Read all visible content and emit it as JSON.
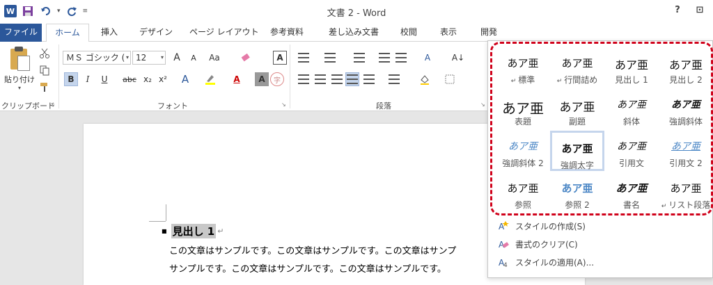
{
  "title_bar": {
    "word_logo": "W",
    "doc_title": "文書 2 - Word",
    "help": "?",
    "ribbon_display": "⊡"
  },
  "tabs": [
    "ファイル",
    "ホーム",
    "挿入",
    "デザイン",
    "ページ レイアウト",
    "参考資料",
    "差し込み文書",
    "校閲",
    "表示",
    "開発"
  ],
  "ribbon": {
    "paste_label": "貼り付け",
    "clipboard_label": "クリップボード",
    "font_label": "フォント",
    "paragraph_label": "段落",
    "font_name": "ＭＳ ゴシック (",
    "font_size": "12",
    "font_buttons": {
      "grow": "A",
      "shrink": "A",
      "case": "Aa",
      "bold": "B",
      "italic": "I",
      "underline": "U",
      "strike": "abc",
      "subscript": "x₂",
      "superscript": "x²",
      "text_effects": "A",
      "font_color": "A",
      "shading": "A",
      "enclose": "字"
    }
  },
  "document": {
    "heading": "見出し 1",
    "lines": [
      "この文章はサンプルです。この文章はサンプルです。この文章はサンプ",
      "サンプルです。この文章はサンプルです。この文章はサンプルです。"
    ]
  },
  "style_gallery": {
    "sample": "あア亜",
    "styles": [
      {
        "name": "標準",
        "prefix": "↵",
        "style": "normal"
      },
      {
        "name": "行間詰め",
        "prefix": "↵",
        "style": "normal"
      },
      {
        "name": "見出し 1",
        "prefix": "",
        "style": "h1"
      },
      {
        "name": "見出し 2",
        "prefix": "",
        "style": "h1"
      },
      {
        "name": "表題",
        "prefix": "",
        "style": "title"
      },
      {
        "name": "副題",
        "prefix": "",
        "style": "subtitle"
      },
      {
        "name": "斜体",
        "prefix": "",
        "style": "italic"
      },
      {
        "name": "強調斜体",
        "prefix": "",
        "style": "bolditalic"
      },
      {
        "name": "強調斜体 2",
        "prefix": "",
        "style": "blueitalic"
      },
      {
        "name": "強調太字",
        "prefix": "",
        "style": "bold"
      },
      {
        "name": "引用文",
        "prefix": "",
        "style": "italic"
      },
      {
        "name": "引用文 2",
        "prefix": "",
        "style": "blueunderline"
      },
      {
        "name": "参照",
        "prefix": "",
        "style": "normal"
      },
      {
        "name": "参照 2",
        "prefix": "",
        "style": "bluebold"
      },
      {
        "name": "書名",
        "prefix": "",
        "style": "bolditalic2"
      },
      {
        "name": "リスト段落",
        "prefix": "↵",
        "style": "normal"
      }
    ],
    "menu": [
      {
        "label": "スタイルの作成(S)",
        "icon": "create-style-icon"
      },
      {
        "label": "書式のクリア(C)",
        "icon": "clear-format-icon"
      },
      {
        "label": "スタイルの適用(A)...",
        "icon": "apply-style-icon"
      }
    ]
  },
  "colors": {
    "accent": "#2b579a",
    "highlight_border": "#d0021b",
    "blue_style": "#4a86c5"
  }
}
